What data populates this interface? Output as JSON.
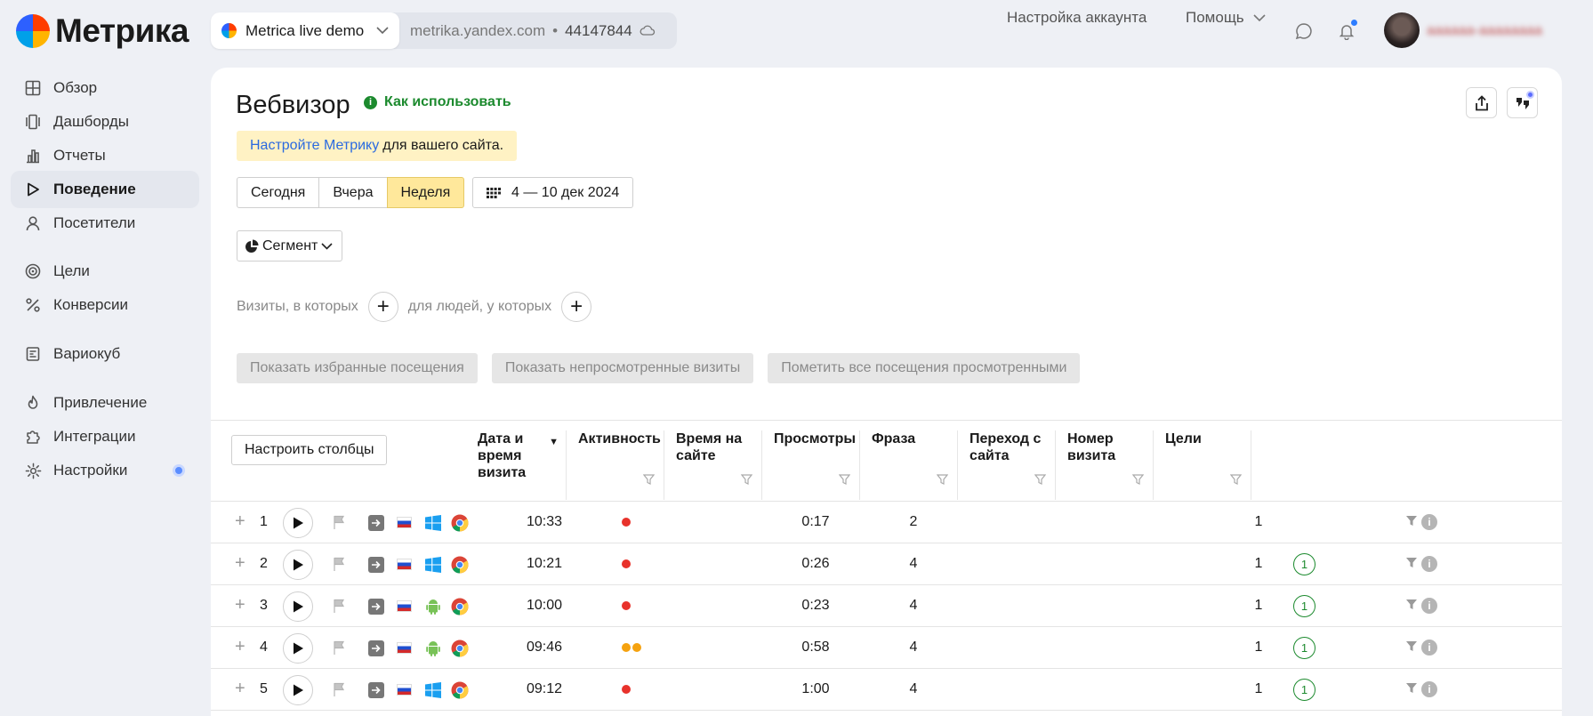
{
  "app": {
    "logo_text": "Метрика"
  },
  "counter": {
    "name": "Metrica live demo",
    "domain": "metrika.yandex.com",
    "separator": "•",
    "id": "44147844"
  },
  "header": {
    "account_settings": "Настройка аккаунта",
    "help": "Помощь",
    "user_name": "аааааа-аааааааа"
  },
  "sidebar": {
    "items": [
      {
        "label": "Обзор",
        "icon": "grid-icon"
      },
      {
        "label": "Дашборды",
        "icon": "dashboards-icon"
      },
      {
        "label": "Отчеты",
        "icon": "reports-icon"
      },
      {
        "label": "Поведение",
        "icon": "play-icon",
        "active": true
      },
      {
        "label": "Посетители",
        "icon": "person-icon"
      },
      {
        "label": "Цели",
        "icon": "target-icon"
      },
      {
        "label": "Конверсии",
        "icon": "percent-icon"
      },
      {
        "label": "Вариокуб",
        "icon": "variocube-icon"
      },
      {
        "label": "Привлечение",
        "icon": "flame-icon"
      },
      {
        "label": "Интеграции",
        "icon": "puzzle-icon"
      },
      {
        "label": "Настройки",
        "icon": "gear-icon"
      }
    ]
  },
  "page": {
    "title": "Вебвизор",
    "howto": "Как использовать",
    "notice_link": "Настройте Метрику",
    "notice_text": "для вашего сайта.",
    "periods": [
      "Сегодня",
      "Вчера",
      "Неделя"
    ],
    "active_period": "Неделя",
    "date_range": "4 — 10 дек 2024",
    "segment": "Сегмент",
    "filter_visits": "Визиты, в которых",
    "filter_people": "для людей, у которых",
    "actions": [
      "Показать избранные посещения",
      "Показать непросмотренные визиты",
      "Пометить все посещения просмотренными"
    ]
  },
  "table": {
    "columns_button": "Настроить столбцы",
    "headers": [
      "Дата и время визита",
      "Активность",
      "Время на сайте",
      "Просмотры",
      "Фраза",
      "Переход с сайта",
      "Номер визита",
      "Цели"
    ],
    "rows": [
      {
        "num": "1",
        "os": "windows",
        "time": "10:33",
        "activity": [
          "#e8322b"
        ],
        "duration": "0:17",
        "views": "2",
        "visit": "1",
        "goals": ""
      },
      {
        "num": "2",
        "os": "windows",
        "time": "10:21",
        "activity": [
          "#e8322b"
        ],
        "duration": "0:26",
        "views": "4",
        "visit": "1",
        "goals": "1"
      },
      {
        "num": "3",
        "os": "android",
        "time": "10:00",
        "activity": [
          "#e8322b"
        ],
        "duration": "0:23",
        "views": "4",
        "visit": "1",
        "goals": "1"
      },
      {
        "num": "4",
        "os": "android",
        "time": "09:46",
        "activity": [
          "#f5a20f",
          "#f5a20f"
        ],
        "duration": "0:58",
        "views": "4",
        "visit": "1",
        "goals": "1"
      },
      {
        "num": "5",
        "os": "windows",
        "time": "09:12",
        "activity": [
          "#e8322b"
        ],
        "duration": "1:00",
        "views": "4",
        "visit": "1",
        "goals": "1"
      }
    ]
  },
  "colors": {
    "accent_green": "#1c8a2e",
    "link_blue": "#2a6ae0",
    "notice_bg": "#fff2c4",
    "active_period_bg": "#ffe89b"
  }
}
